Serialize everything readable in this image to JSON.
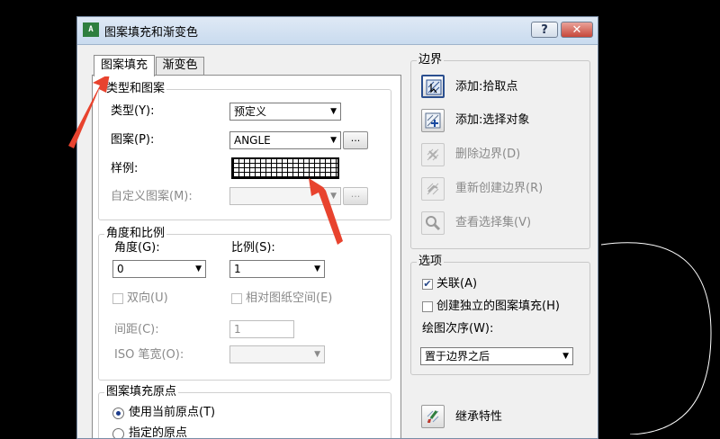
{
  "window": {
    "title": "图案填充和渐变色",
    "app_icon_text": "A",
    "help_label": "?",
    "close_label": "✕"
  },
  "tabs": [
    {
      "label": "图案填充",
      "active": true
    },
    {
      "label": "渐变色",
      "active": false
    }
  ],
  "type_pattern": {
    "title": "类型和图案",
    "type_label": "类型(Y):",
    "type_value": "预定义",
    "pattern_label": "图案(P):",
    "pattern_value": "ANGLE",
    "browse_label": "...",
    "sample_label": "样例:",
    "custom_label": "自定义图案(M):",
    "custom_value": "",
    "custom_browse_label": "..."
  },
  "angle_scale": {
    "title": "角度和比例",
    "angle_label": "角度(G):",
    "angle_value": "0",
    "scale_label": "比例(S):",
    "scale_value": "1",
    "double_label": "双向(U)",
    "relative_label": "相对图纸空间(E)",
    "spacing_label": "间距(C):",
    "spacing_value": "1",
    "iso_label": "ISO 笔宽(O):",
    "iso_value": ""
  },
  "origin": {
    "title": "图案填充原点",
    "use_current_label": "使用当前原点(T)",
    "specified_label": "指定的原点"
  },
  "boundaries": {
    "title": "边界",
    "items": [
      {
        "label": "添加:拾取点",
        "icon": "pick-points-icon",
        "enabled": true
      },
      {
        "label": "添加:选择对象",
        "icon": "select-objects-icon",
        "enabled": true
      },
      {
        "label": "删除边界(D)",
        "icon": "remove-boundaries-icon",
        "enabled": false
      },
      {
        "label": "重新创建边界(R)",
        "icon": "recreate-boundary-icon",
        "enabled": false
      },
      {
        "label": "查看选择集(V)",
        "icon": "view-selections-icon",
        "enabled": false
      }
    ]
  },
  "options": {
    "title": "选项",
    "associative_label": "关联(A)",
    "associative_checked": true,
    "separate_label": "创建独立的图案填充(H)",
    "separate_checked": false,
    "draw_order_label": "绘图次序(W):",
    "draw_order_value": "置于边界之后"
  },
  "inherit": {
    "label": "继承特性"
  },
  "colors": {
    "annotation_red": "#e8432e",
    "dialog_bg": "#f0f0f0",
    "titlebar": "#c9dbef",
    "close_red": "#c7473a"
  }
}
